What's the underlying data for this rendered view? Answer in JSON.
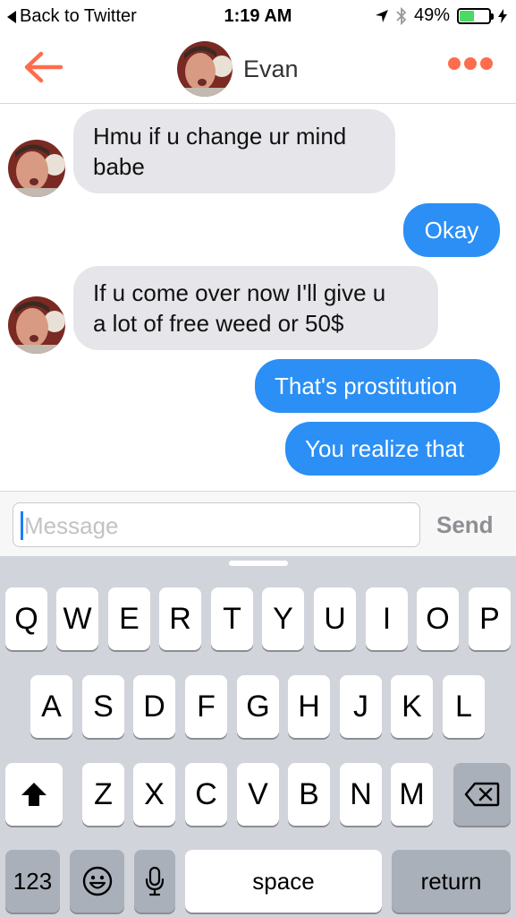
{
  "status_bar": {
    "back_label": "Back to Twitter",
    "time": "1:19 AM",
    "battery": "49%",
    "battery_level": 0.49
  },
  "header": {
    "contact_name": "Evan"
  },
  "messages": [
    {
      "direction": "incoming",
      "text_lines": [
        "Hmu if u change ur mind",
        "babe"
      ]
    },
    {
      "direction": "outgoing",
      "text_lines": [
        "Okay"
      ]
    },
    {
      "direction": "incoming",
      "text_lines": [
        "If u come over now I'll give u",
        "a lot of free weed or 50$"
      ]
    },
    {
      "direction": "outgoing",
      "text_lines": [
        "That's prostitution"
      ]
    },
    {
      "direction": "outgoing",
      "text_lines": [
        "You realize that"
      ]
    }
  ],
  "composer": {
    "placeholder": "Message",
    "send_label": "Send"
  },
  "keyboard": {
    "row1": [
      "Q",
      "W",
      "E",
      "R",
      "T",
      "Y",
      "U",
      "I",
      "O",
      "P"
    ],
    "row2": [
      "A",
      "S",
      "D",
      "F",
      "G",
      "H",
      "J",
      "K",
      "L"
    ],
    "row3": [
      "Z",
      "X",
      "C",
      "V",
      "B",
      "N",
      "M"
    ],
    "numbers_label": "123",
    "space_label": "space",
    "return_label": "return"
  },
  "colors": {
    "accent": "#fd6d4d",
    "outgoing_bubble": "#2b8ff5",
    "incoming_bubble": "#e6e5ea",
    "battery_fill": "#4cd964"
  }
}
